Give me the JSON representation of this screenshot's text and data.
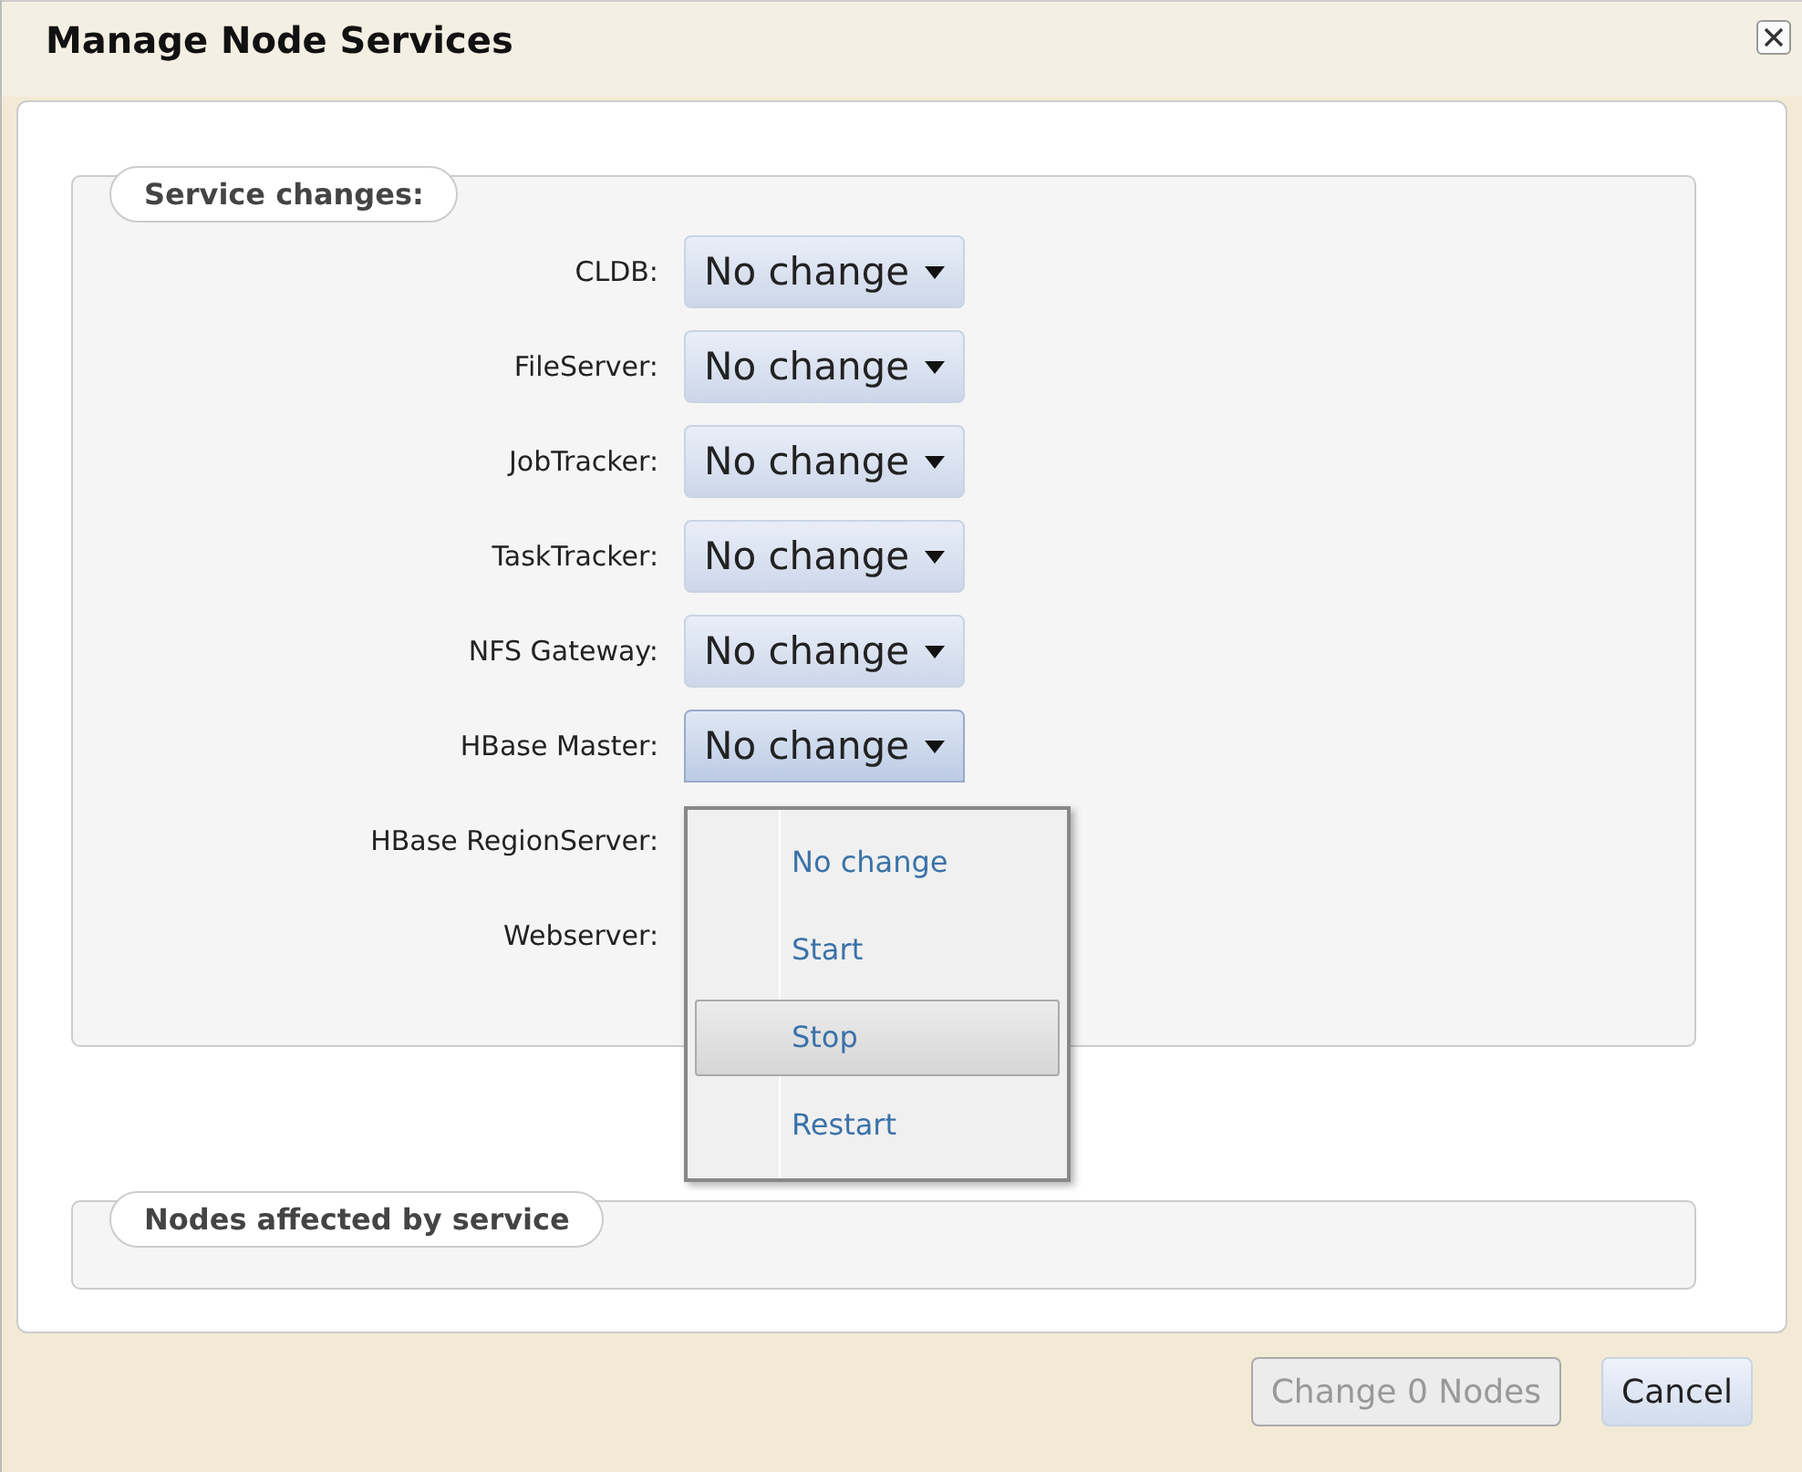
{
  "window": {
    "title": "Manage Node Services"
  },
  "service_changes": {
    "legend": "Service changes:",
    "rows": [
      {
        "label": "CLDB:",
        "value": "No change"
      },
      {
        "label": "FileServer:",
        "value": "No change"
      },
      {
        "label": "JobTracker:",
        "value": "No change"
      },
      {
        "label": "TaskTracker:",
        "value": "No change"
      },
      {
        "label": "NFS Gateway:",
        "value": "No change"
      },
      {
        "label": "HBase Master:",
        "value": "No change",
        "expanded": true
      },
      {
        "label": "HBase RegionServer:"
      },
      {
        "label": "Webserver:"
      }
    ]
  },
  "dropdown_menu": {
    "items": [
      {
        "label": "No change",
        "selected": false
      },
      {
        "label": "Start",
        "selected": false
      },
      {
        "label": "Stop",
        "selected": true
      },
      {
        "label": "Restart",
        "selected": false
      }
    ]
  },
  "nodes_affected": {
    "legend": "Nodes affected by service"
  },
  "buttons": [
    {
      "label": "Change 0 Nodes",
      "disabled": true
    },
    {
      "label": "Cancel",
      "disabled": false
    }
  ]
}
